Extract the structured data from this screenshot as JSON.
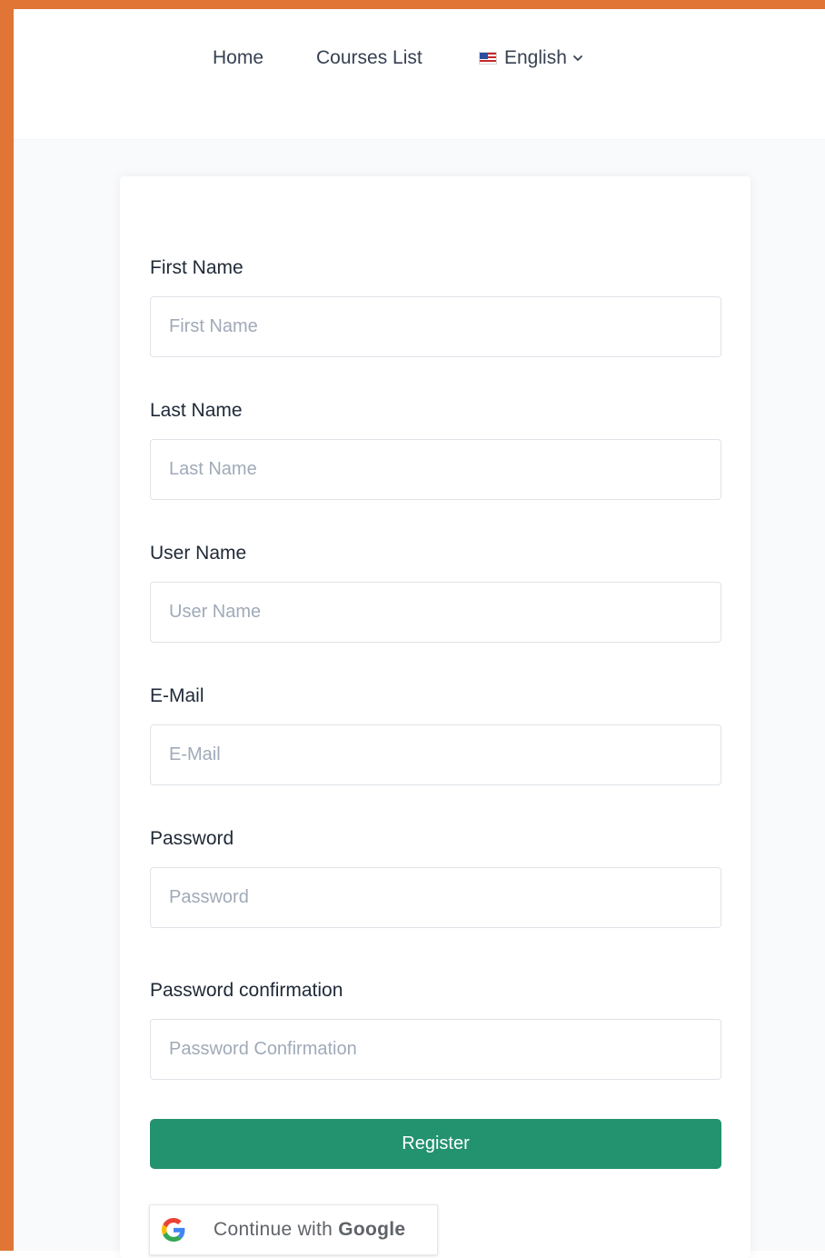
{
  "nav": {
    "home": "Home",
    "courses": "Courses List",
    "language": "English"
  },
  "form": {
    "fields": [
      {
        "label": "First Name",
        "placeholder": "First Name"
      },
      {
        "label": "Last Name",
        "placeholder": "Last Name"
      },
      {
        "label": "User Name",
        "placeholder": "User Name"
      },
      {
        "label": "E-Mail",
        "placeholder": "E-Mail"
      },
      {
        "label": "Password",
        "placeholder": "Password"
      },
      {
        "label": "Password confirmation",
        "placeholder": "Password Confirmation"
      }
    ],
    "register": "Register",
    "google_prefix": "Continue with",
    "google_brand": "Google"
  },
  "colors": {
    "frame": "#e07535",
    "primary": "#23926e"
  },
  "icons": {
    "flag": "us-flag-icon",
    "chevron": "chevron-down-icon",
    "google": "google-logo-icon"
  }
}
